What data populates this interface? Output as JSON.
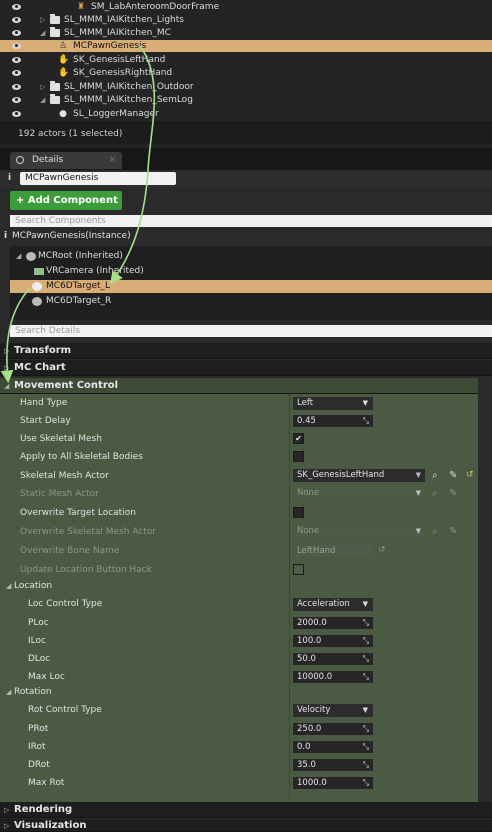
{
  "outliner": {
    "rows": [
      {
        "label": "SM_LabAnteroomDoorFrame"
      },
      {
        "label": "SL_MMM_IAIKitchen_Lights"
      },
      {
        "label": "SL_MMM_IAIKitchen_MC"
      },
      {
        "label": "MCPawnGenesis"
      },
      {
        "label": "SK_GenesisLeftHand"
      },
      {
        "label": "SK_GenesisRightHand"
      },
      {
        "label": "SL_MMM_IAIKitchen_Outdoor"
      },
      {
        "label": "SL_MMM_IAIKitchen_SemLog"
      },
      {
        "label": "SL_LoggerManager"
      }
    ],
    "actor_count": "192 actors (1 selected)"
  },
  "details": {
    "tab_label": "Details",
    "tab_close": "×",
    "info_glyph": "i",
    "name_value": "MCPawnGenesis",
    "add_component_label": "+ Add Component ▾",
    "search_components_placeholder": "Search Components",
    "instance_label": "MCPawnGenesis(Instance)",
    "components": [
      {
        "label": "MCRoot (Inherited)"
      },
      {
        "label": "VRCamera (Inherited)"
      },
      {
        "label": "MC6DTarget_L"
      },
      {
        "label": "MC6DTarget_R"
      }
    ],
    "search_details_placeholder": "Search Details",
    "categories": {
      "transform": "Transform",
      "mc_chart": "MC Chart",
      "movement_control": "Movement Control",
      "rendering": "Rendering",
      "visualization": "Visualization"
    }
  },
  "movement": {
    "hand_type": {
      "label": "Hand Type",
      "value": "Left"
    },
    "start_delay": {
      "label": "Start Delay",
      "value": "0.45"
    },
    "use_skeletal_mesh": {
      "label": "Use Skeletal Mesh",
      "checked": "✔"
    },
    "apply_all_bodies": {
      "label": "Apply to All Skeletal Bodies",
      "checked": ""
    },
    "skeletal_mesh_actor": {
      "label": "Skeletal Mesh Actor",
      "value": "SK_GenesisLeftHand"
    },
    "static_mesh_actor": {
      "label": "Static Mesh Actor",
      "value": "None"
    },
    "overwrite_target_location": {
      "label": "Overwrite Target Location",
      "checked": ""
    },
    "overwrite_skeletal_mesh_actor": {
      "label": "Overwrite Skeletal Mesh Actor",
      "value": "None"
    },
    "overwrite_bone_name": {
      "label": "Overwrite Bone Name",
      "value": "LeftHand"
    },
    "update_location_hack": {
      "label": "Update Location Button Hack",
      "checked": ""
    },
    "location": {
      "title": "Location",
      "control_type": {
        "label": "Loc Control Type",
        "value": "Acceleration"
      },
      "ploc": {
        "label": "PLoc",
        "value": "2000.0"
      },
      "iloc": {
        "label": "ILoc",
        "value": "100.0"
      },
      "dloc": {
        "label": "DLoc",
        "value": "50.0"
      },
      "max_loc": {
        "label": "Max Loc",
        "value": "10000.0"
      }
    },
    "rotation": {
      "title": "Rotation",
      "control_type": {
        "label": "Rot Control Type",
        "value": "Velocity"
      },
      "prot": {
        "label": "PRot",
        "value": "250.0"
      },
      "irot": {
        "label": "IRot",
        "value": "0.0"
      },
      "drot": {
        "label": "DRot",
        "value": "35.0"
      },
      "max_rot": {
        "label": "Max Rot",
        "value": "1000.0"
      }
    }
  },
  "glyphs": {
    "spinner": "⤡",
    "chevron": "▼",
    "expand": "◢",
    "collapse": "▷",
    "browse": "⌕",
    "pick": "✎",
    "reset": "↺"
  },
  "colors": {
    "selection": "#d8ad76",
    "panel_highlight": "#4a5a43",
    "add_button": "#3c9c3c",
    "arrow": "#a8e08a"
  }
}
